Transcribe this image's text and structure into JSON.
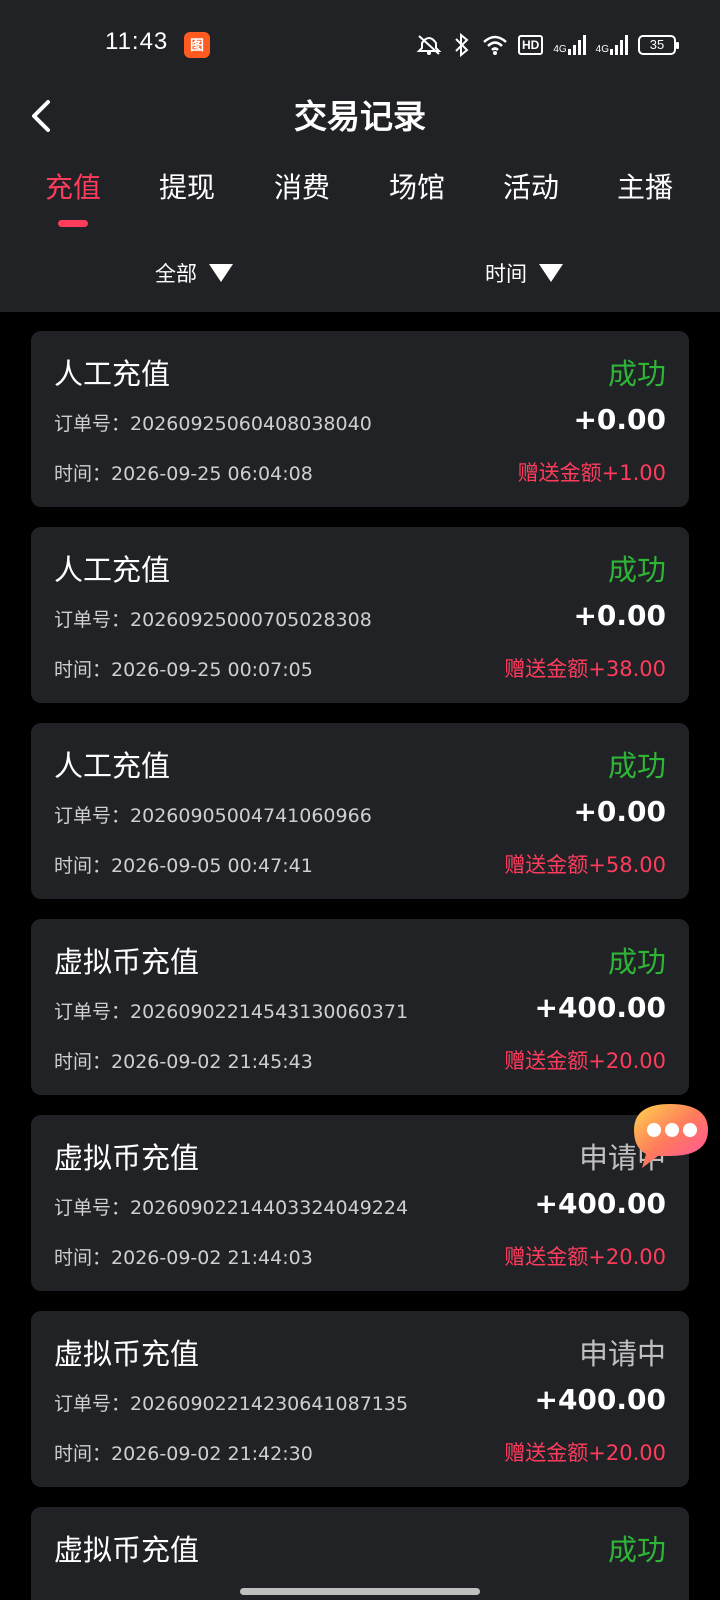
{
  "status_bar": {
    "time": "11:43",
    "app_badge": "图",
    "net1": "4G",
    "net2": "4G",
    "hd": "HD",
    "battery": "35"
  },
  "navbar": {
    "title": "交易记录"
  },
  "tabs": [
    {
      "label": "充值",
      "active": true
    },
    {
      "label": "提现",
      "active": false
    },
    {
      "label": "消费",
      "active": false
    },
    {
      "label": "场馆",
      "active": false
    },
    {
      "label": "活动",
      "active": false
    },
    {
      "label": "主播",
      "active": false
    }
  ],
  "filters": {
    "type": "全部",
    "time": "时间"
  },
  "records": [
    {
      "title": "人工充值",
      "status": "成功",
      "status_kind": "ok",
      "order_label": "订单号：",
      "order_no": "20260925060408038040",
      "amount": "+0.00",
      "time_label": "时间：",
      "time": "2026-09-25 06:04:08",
      "bonus": "赠送金额+1.00"
    },
    {
      "title": "人工充值",
      "status": "成功",
      "status_kind": "ok",
      "order_label": "订单号：",
      "order_no": "20260925000705028308",
      "amount": "+0.00",
      "time_label": "时间：",
      "time": "2026-09-25 00:07:05",
      "bonus": "赠送金额+38.00"
    },
    {
      "title": "人工充值",
      "status": "成功",
      "status_kind": "ok",
      "order_label": "订单号：",
      "order_no": "20260905004741060966",
      "amount": "+0.00",
      "time_label": "时间：",
      "time": "2026-09-05 00:47:41",
      "bonus": "赠送金额+58.00"
    },
    {
      "title": "虚拟币充值",
      "status": "成功",
      "status_kind": "ok",
      "order_label": "订单号：",
      "order_no": "202609022145431300603 71",
      "amount": "+400.00",
      "time_label": "时间：",
      "time": "2026-09-02 21:45:43",
      "bonus": "赠送金额+20.00"
    },
    {
      "title": "虚拟币充值",
      "status": "申请中",
      "status_kind": "pending",
      "order_label": "订单号：",
      "order_no": "2026090221440332404922 4",
      "amount": "+400.00",
      "time_label": "时间：",
      "time": "2026-09-02 21:44:03",
      "bonus": "赠送金额+20.00"
    },
    {
      "title": "虚拟币充值",
      "status": "申请中",
      "status_kind": "pending",
      "order_label": "订单号：",
      "order_no": "2026090221423064108713 5",
      "amount": "+400.00",
      "time_label": "时间：",
      "time": "2026-09-02 21:42:30",
      "bonus": "赠送金额+20.00"
    },
    {
      "title": "虚拟币充值",
      "status": "成功",
      "status_kind": "ok",
      "order_label": "",
      "order_no": "",
      "amount": "",
      "time_label": "",
      "time": "",
      "bonus": ""
    }
  ],
  "colors": {
    "accent": "#ff3c5c",
    "success": "#2fb536",
    "pending": "#bfbfbf",
    "card_bg": "#202226"
  }
}
